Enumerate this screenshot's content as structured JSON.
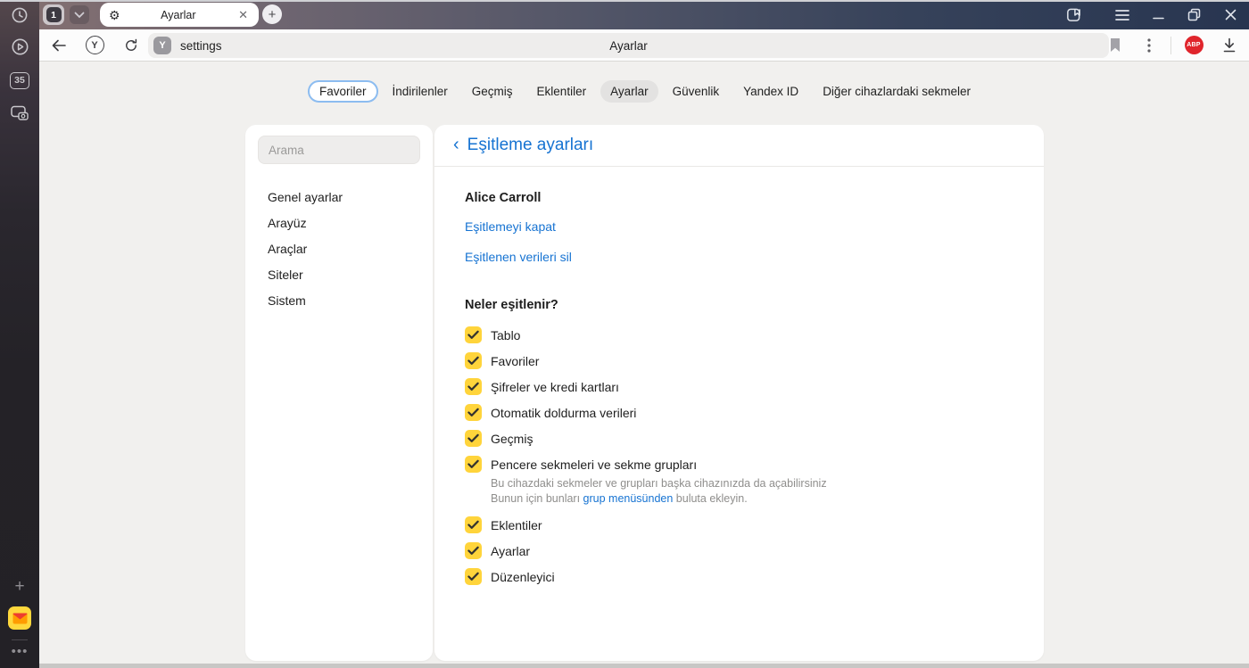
{
  "browser": {
    "tab_counter": "1",
    "tab_title": "Ayarlar",
    "url": "settings",
    "page_title": "Ayarlar",
    "adblock_badge": "ABP",
    "sidebar_badge_number": "35",
    "yandex_button": "Y",
    "favicon_letter": "Y"
  },
  "nav": {
    "items": [
      {
        "label": "Favoriler",
        "state": "focused"
      },
      {
        "label": "İndirilenler",
        "state": "normal"
      },
      {
        "label": "Geçmiş",
        "state": "normal"
      },
      {
        "label": "Eklentiler",
        "state": "normal"
      },
      {
        "label": "Ayarlar",
        "state": "active"
      },
      {
        "label": "Güvenlik",
        "state": "normal"
      },
      {
        "label": "Yandex ID",
        "state": "normal"
      },
      {
        "label": "Diğer cihazlardaki sekmeler",
        "state": "normal"
      }
    ]
  },
  "sidebar": {
    "search_placeholder": "Arama",
    "items": [
      "Genel ayarlar",
      "Arayüz",
      "Araçlar",
      "Siteler",
      "Sistem"
    ]
  },
  "sync": {
    "title": "Eşitleme ayarları",
    "account": "Alice Carroll",
    "link_disable": "Eşitlemeyi kapat",
    "link_delete": "Eşitlenen verileri sil",
    "heading": "Neler eşitlenir?",
    "items": [
      {
        "label": "Tablo",
        "checked": true
      },
      {
        "label": "Favoriler",
        "checked": true
      },
      {
        "label": "Şifreler ve kredi kartları",
        "checked": true
      },
      {
        "label": "Otomatik doldurma verileri",
        "checked": true
      },
      {
        "label": "Geçmiş",
        "checked": true
      },
      {
        "label": "Pencere sekmeleri ve sekme grupları",
        "checked": true,
        "description": {
          "line1": "Bu cihazdaki sekmeler ve grupları başka cihazınızda da açabilirsiniz",
          "line2_prefix": "Bunun için bunları ",
          "line2_link": "grup menüsünden",
          "line2_suffix": " buluta ekleyin."
        }
      },
      {
        "label": "Eklentiler",
        "checked": true
      },
      {
        "label": "Ayarlar",
        "checked": true
      },
      {
        "label": "Düzenleyici",
        "checked": true
      }
    ]
  },
  "colors": {
    "accent_blue": "#1673d2",
    "checkbox_yellow": "#ffd43b",
    "badge_red": "#e0252c",
    "titlebar_navy": "#283650"
  }
}
